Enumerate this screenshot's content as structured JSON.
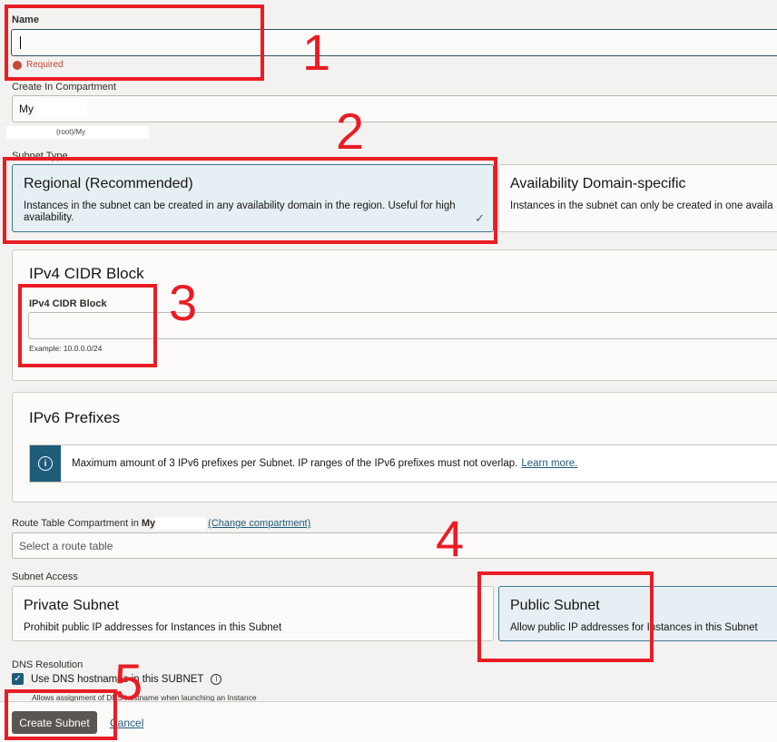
{
  "name_field": {
    "label": "Name",
    "value": "",
    "error": "Required"
  },
  "compartment": {
    "label": "Create In Compartment",
    "value": "My",
    "path": "(root)/My"
  },
  "subnet_type": {
    "label": "Subnet Type",
    "options": [
      {
        "title": "Regional (Recommended)",
        "desc": "Instances in the subnet can be created in any availability domain in the region. Useful for high availability.",
        "selected": true
      },
      {
        "title": "Availability Domain-specific",
        "desc": "Instances in the subnet can only be created in one availa",
        "selected": false
      }
    ]
  },
  "ipv4": {
    "section_title": "IPv4 CIDR Block",
    "label": "IPv4 CIDR Block",
    "value": "",
    "hint": "Example: 10.0.0.0/24"
  },
  "ipv6": {
    "section_title": "IPv6 Prefixes",
    "info": "Maximum amount of 3 IPv6 prefixes per Subnet. IP ranges of the IPv6 prefixes must not overlap.",
    "link": "Learn more."
  },
  "route_table": {
    "label": "Route Table Compartment in",
    "compartment": "My",
    "change_link": "(Change compartment)",
    "placeholder": "Select a route table"
  },
  "subnet_access": {
    "label": "Subnet Access",
    "options": [
      {
        "title": "Private Subnet",
        "desc": "Prohibit public IP addresses for Instances in this Subnet",
        "selected": false
      },
      {
        "title": "Public Subnet",
        "desc": "Allow public IP addresses for Instances in this Subnet",
        "selected": true
      }
    ]
  },
  "dns": {
    "label": "DNS Resolution",
    "checkbox": "Use DNS hostnames in this SUBNET",
    "checked": true,
    "hint": "Allows assignment of DNS hostname when launching an Instance"
  },
  "footer": {
    "create": "Create Subnet",
    "cancel": "Cancel"
  },
  "annotations": [
    "1",
    "2",
    "3",
    "4",
    "5"
  ],
  "colors": {
    "accent": "#3f7590",
    "error": "#c74634",
    "annotation": "#ea1c24",
    "primary_button": "#5b5652"
  }
}
